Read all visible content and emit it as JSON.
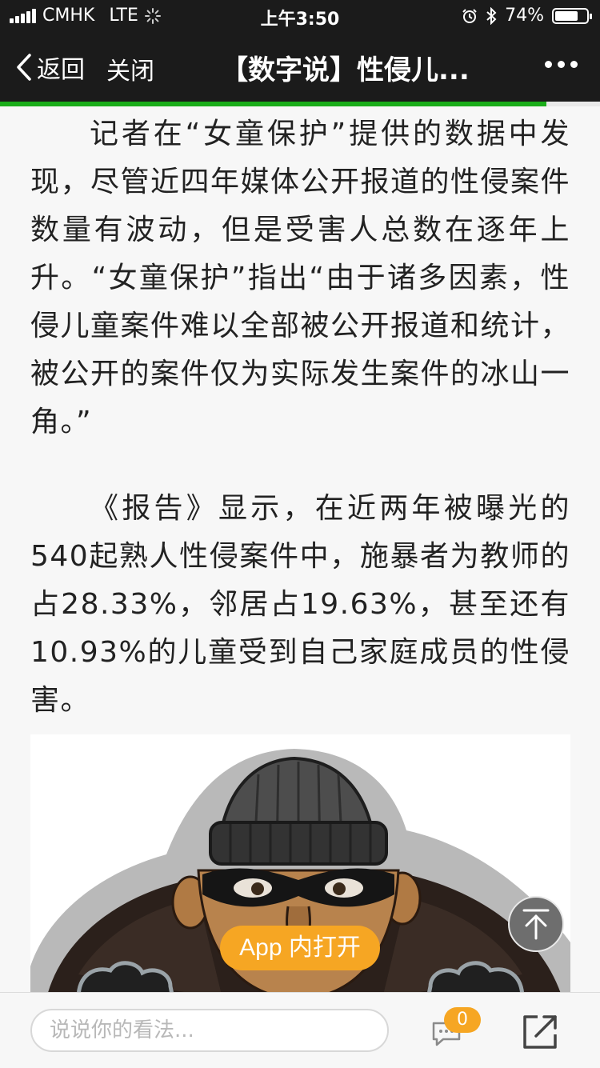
{
  "status_bar": {
    "carrier": "CMHK",
    "network": "LTE",
    "time": "上午3:50",
    "battery_percent": "74%",
    "battery_level": 0.74
  },
  "nav": {
    "back_label": "返回",
    "close_label": "关闭",
    "title": "【数字说】性侵儿...",
    "more_icon": "more-dots-icon"
  },
  "load_progress": 0.91,
  "article": {
    "paragraphs": [
      "记者在“女童保护”提供的数据中发现，尽管近四年媒体公开报道的性侵案件数量有波动，但是受害人总数在逐年上升。“女童保护”指出“由于诸多因素，性侵儿童案件难以全部被公开报道和统计，被公开的案件仅为实际发生案件的冰山一角。”",
      "《报告》显示，在近两年被曝光的540起熟人性侵案件中，施暴者为教师的占28.33%，邻居占19.63%，甚至还有10.93%的儿童受到自己家庭成员的性侵害。"
    ]
  },
  "floating": {
    "back_to_top_icon": "arrow-up-to-top-icon",
    "open_in_app_label": "App 内打开"
  },
  "bottom_bar": {
    "comment_placeholder": "说说你的看法...",
    "comment_count": "0",
    "comment_icon": "comment-bubble-icon",
    "share_icon": "share-external-icon"
  },
  "colors": {
    "header_bg": "#1b1b1b",
    "progress_green": "#1aad19",
    "accent_orange": "#f6a623"
  }
}
